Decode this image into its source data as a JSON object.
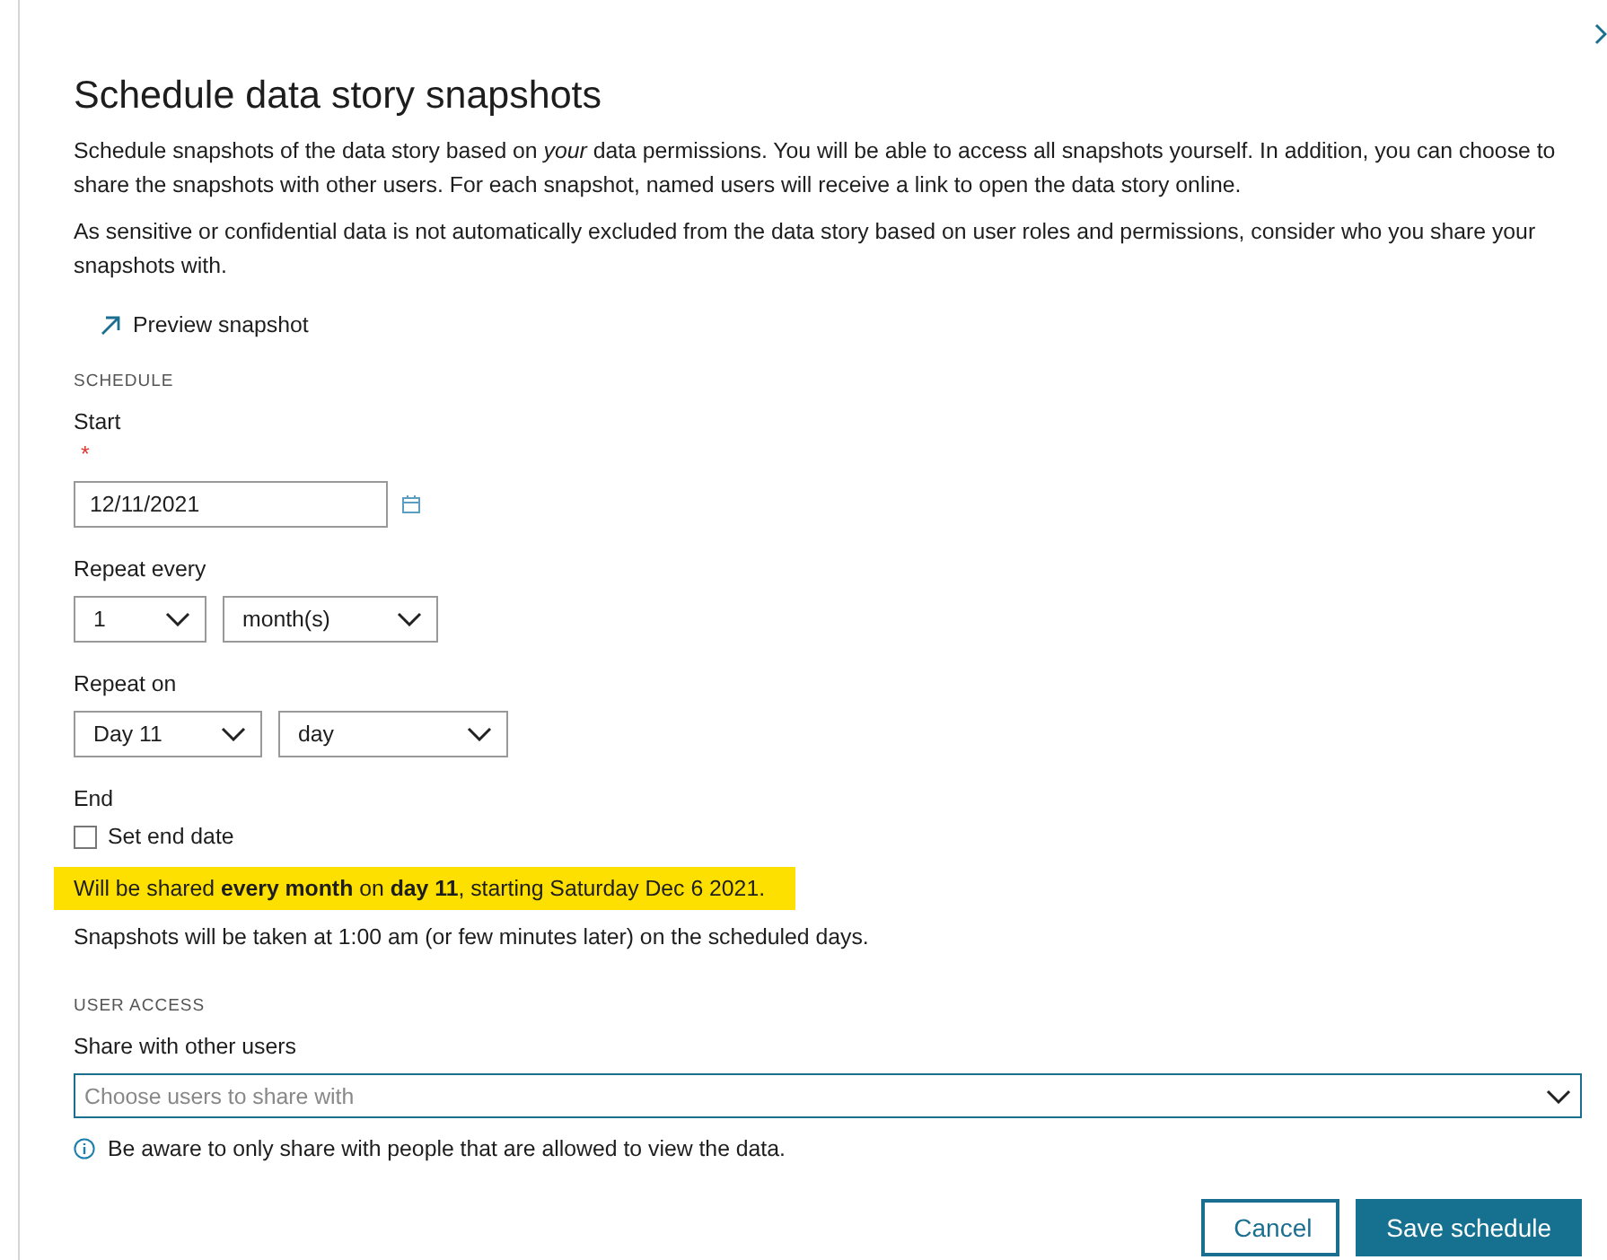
{
  "dialog": {
    "title": "Schedule data story snapshots",
    "intro": [
      "Schedule snapshots of the data story based on *your* data permissions. You will be able to access all snapshots yourself. In addition, you can choose to share the snapshots with other users. For each snapshot, named users will receive a link to open the data story online.",
      "As sensitive or confidential data is not automatically excluded from the data story based on user roles and permissions, consider who you share your snapshots with."
    ],
    "preview_link": "Preview snapshot",
    "schedule": {
      "heading": "SCHEDULE",
      "start": {
        "label": "Start",
        "required_mark": "*",
        "value": "12/11/2021"
      },
      "repeat_every": {
        "label": "Repeat every",
        "selects": [
          {
            "value": "1"
          },
          {
            "value": "month(s)"
          }
        ]
      },
      "repeat_on": {
        "label": "Repeat on",
        "selects": [
          {
            "value": "Day 11"
          },
          {
            "value": "day"
          }
        ]
      },
      "end": {
        "label": "End",
        "checkbox": {
          "label": "Set end date",
          "checked": false
        }
      },
      "summary": "Will be shared **every month** on **day 11**, starting Saturday Dec 6 2021.",
      "note": "Snapshots will be taken at 1:00 am (or few minutes later) on the scheduled days."
    },
    "user_access": {
      "heading": "USER ACCESS",
      "label": "Share with other users",
      "placeholder": "Choose users to share with",
      "info": "Be aware to only share with people that are allowed to view the data."
    },
    "buttons": [
      {
        "label": "Cancel",
        "kind": "secondary"
      },
      {
        "label": "Save schedule",
        "kind": "primary"
      }
    ]
  }
}
